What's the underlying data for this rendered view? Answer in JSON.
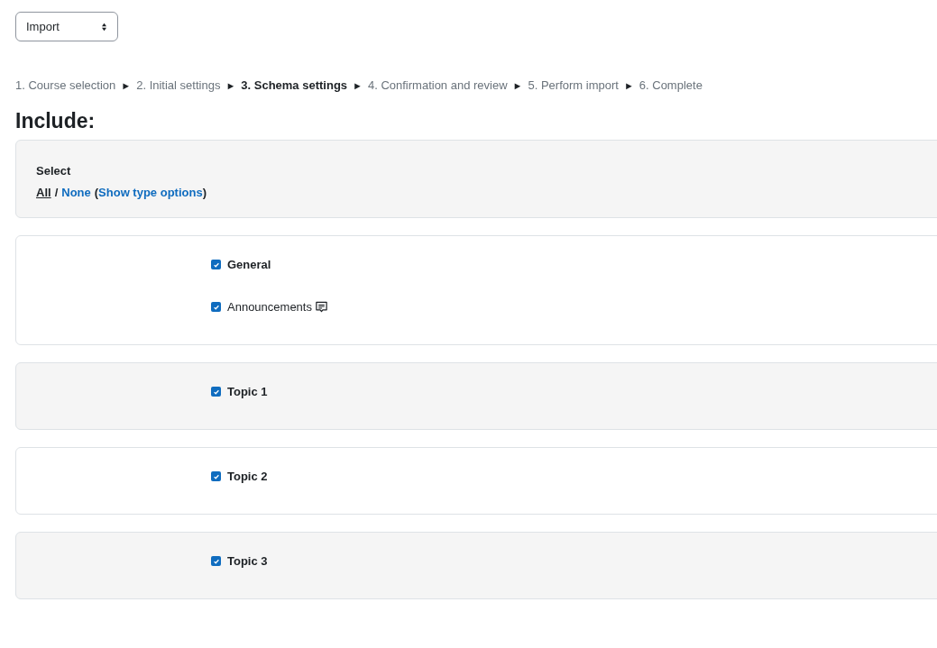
{
  "action_select": {
    "value": "Import"
  },
  "steps": [
    {
      "label": "1. Course selection",
      "selected": false
    },
    {
      "label": "2. Initial settings",
      "selected": false
    },
    {
      "label": "3. Schema settings",
      "selected": true
    },
    {
      "label": "4. Confirmation and review",
      "selected": false
    },
    {
      "label": "5. Perform import",
      "selected": false
    },
    {
      "label": "6. Complete",
      "selected": false
    }
  ],
  "step_separator": "►",
  "heading": "Include:",
  "select_box": {
    "label": "Select",
    "all": "All",
    "slash": "/",
    "none": "None",
    "open_paren": "(",
    "show_types": "Show type options",
    "close_paren": ")"
  },
  "sections": [
    {
      "items": [
        {
          "kind": "section",
          "label": "General",
          "checked": true
        },
        {
          "kind": "activity",
          "label": "Announcements",
          "checked": true
        }
      ]
    },
    {
      "items": [
        {
          "kind": "section",
          "label": "Topic 1",
          "checked": true
        }
      ]
    },
    {
      "items": [
        {
          "kind": "section",
          "label": "Topic 2",
          "checked": true
        }
      ]
    },
    {
      "items": [
        {
          "kind": "section",
          "label": "Topic 3",
          "checked": true
        }
      ]
    }
  ]
}
